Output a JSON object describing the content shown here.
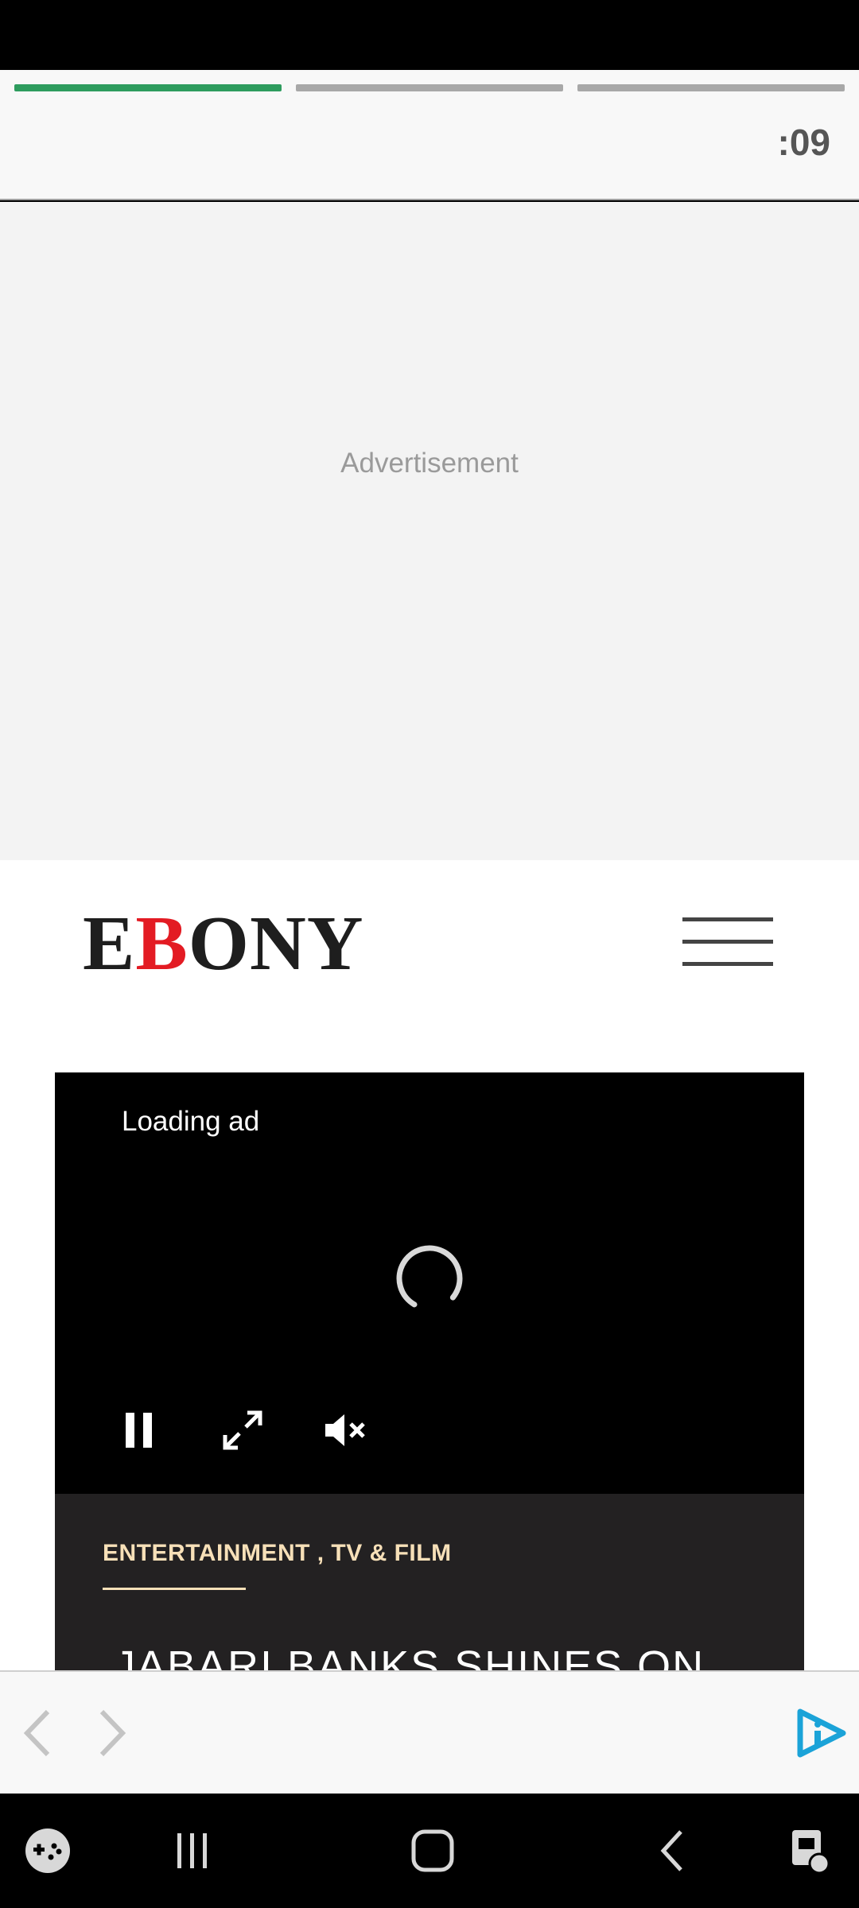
{
  "story": {
    "progress_segments": [
      {
        "state": "active"
      },
      {
        "state": "inactive"
      },
      {
        "state": "inactive"
      }
    ],
    "timer": ":09"
  },
  "ad": {
    "label": "Advertisement"
  },
  "site": {
    "logo_prefix": "E",
    "logo_accent": "B",
    "logo_suffix": "ONY",
    "logo_accent_color": "#e31b23",
    "menu_icon": "hamburger-icon"
  },
  "video": {
    "status_text": "Loading ad",
    "controls": [
      "pause-icon",
      "fullscreen-icon",
      "mute-icon"
    ]
  },
  "article": {
    "category": "ENTERTAINMENT , TV & FILM",
    "title_partial": "JABARI BANKS SHINES ON",
    "accent_color": "#f7e0b8"
  },
  "browser_nav": {
    "icons": [
      "back-arrow-icon",
      "forward-arrow-icon",
      "browser-brand-icon"
    ],
    "brand_color": "#1ba3d8"
  },
  "system_nav": {
    "icons": [
      "game-launcher-icon",
      "recent-apps-icon",
      "home-icon",
      "back-icon",
      "screenshot-assist-icon"
    ]
  },
  "colors": {
    "progress_active": "#2e9c5e",
    "progress_inactive": "#a8a8a8"
  }
}
